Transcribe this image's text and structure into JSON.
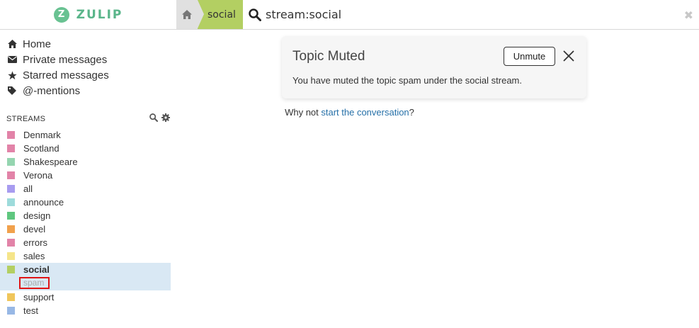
{
  "header": {
    "logo_letter": "Z",
    "logo_text": "ZULIP",
    "breadcrumb_stream": "social",
    "search_value": "stream:social",
    "clear_glyph": "✖"
  },
  "nav": {
    "items": [
      {
        "label": "Home",
        "icon": "home-icon"
      },
      {
        "label": "Private messages",
        "icon": "envelope-icon"
      },
      {
        "label": "Starred messages",
        "icon": "star-icon"
      },
      {
        "label": "@-mentions",
        "icon": "tag-icon"
      }
    ]
  },
  "streams": {
    "label": "STREAMS",
    "items": [
      {
        "name": "Denmark",
        "color": "#e283a8"
      },
      {
        "name": "Scotland",
        "color": "#e283a8"
      },
      {
        "name": "Shakespeare",
        "color": "#95d5b0"
      },
      {
        "name": "Verona",
        "color": "#e283a8"
      },
      {
        "name": "all",
        "color": "#a89cf0"
      },
      {
        "name": "announce",
        "color": "#9ddbdb"
      },
      {
        "name": "design",
        "color": "#5fc77f"
      },
      {
        "name": "devel",
        "color": "#f1a14c"
      },
      {
        "name": "errors",
        "color": "#e283a8"
      },
      {
        "name": "sales",
        "color": "#f5e58a"
      },
      {
        "name": "social",
        "color": "#b3cf62",
        "active": true
      },
      {
        "name": "support",
        "color": "#f0c65b"
      },
      {
        "name": "test",
        "color": "#98b8e5"
      }
    ],
    "topic": "spam"
  },
  "empty": {
    "prefix": "Why not ",
    "link": "start the conversation",
    "suffix": "?"
  },
  "alert": {
    "title": "Topic Muted",
    "message": "You have muted the topic spam under the social stream.",
    "unmute_label": "Unmute"
  }
}
